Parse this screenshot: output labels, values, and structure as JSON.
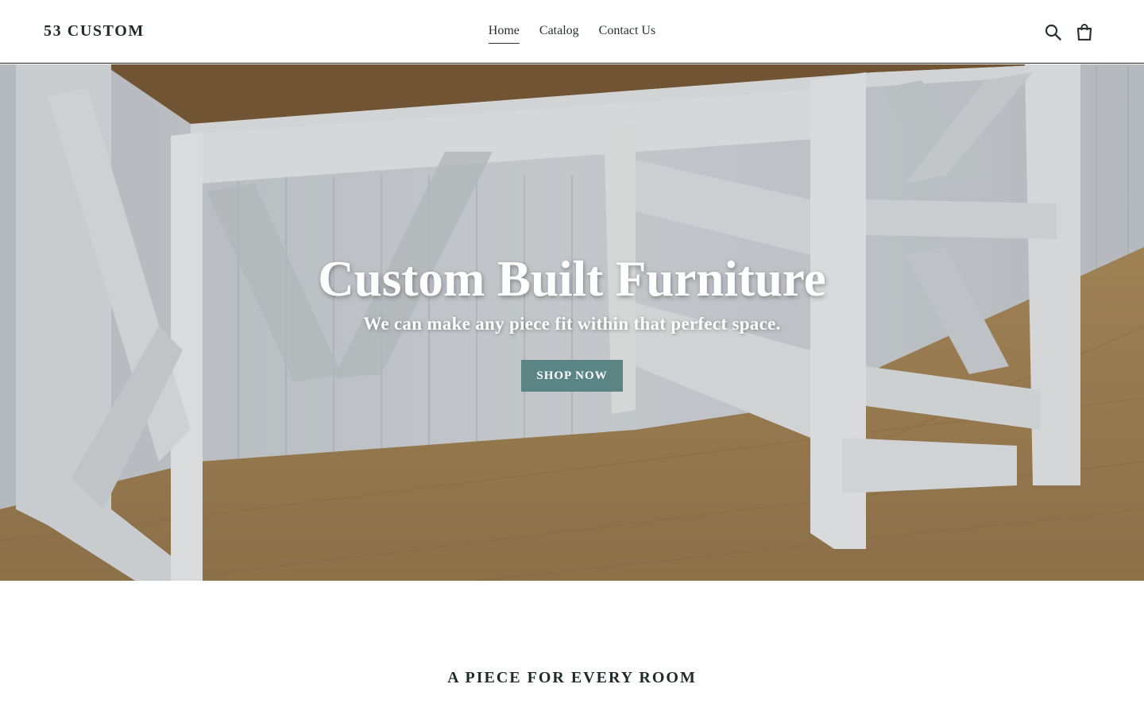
{
  "header": {
    "logo": "53 CUSTOM",
    "nav": [
      {
        "label": "Home",
        "active": true
      },
      {
        "label": "Catalog",
        "active": false
      },
      {
        "label": "Contact Us",
        "active": false
      }
    ],
    "icons": [
      "search-icon",
      "cart-icon"
    ]
  },
  "hero": {
    "title": "Custom Built Furniture",
    "subtitle": "We can make any piece fit within that perfect space.",
    "button_label": "SHOP NOW",
    "button_color": "#5b8585",
    "image": "white-desk-with-wood-top-icon"
  },
  "section": {
    "title": "A PIECE FOR EVERY ROOM"
  }
}
